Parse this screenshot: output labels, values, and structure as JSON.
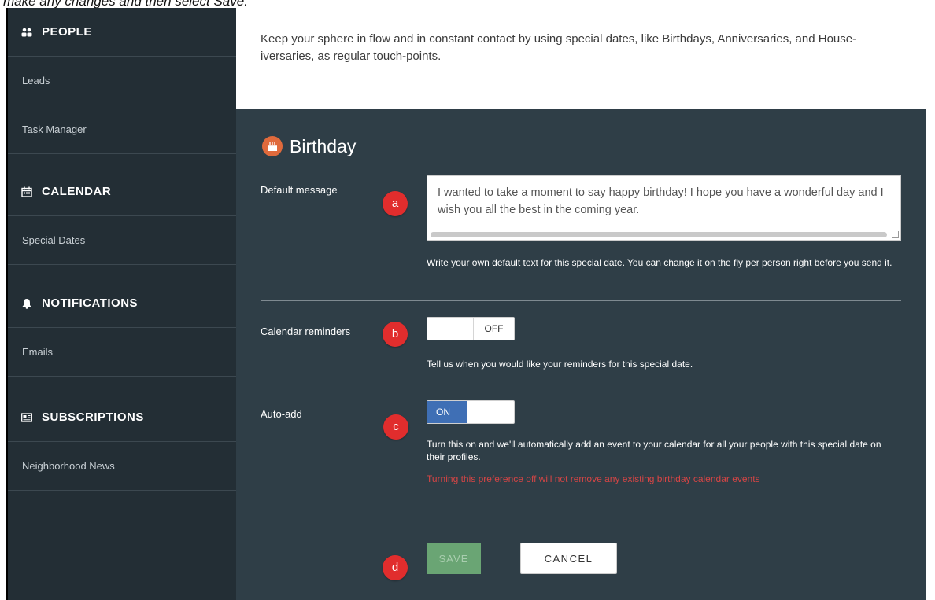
{
  "caption": "make any changes and then select Save.",
  "sidebar": {
    "sections": [
      {
        "id": "people",
        "label": "PEOPLE",
        "icon": "people-icon"
      },
      {
        "id": "calendar",
        "label": "CALENDAR",
        "icon": "calendar-icon"
      },
      {
        "id": "notifications",
        "label": "NOTIFICATIONS",
        "icon": "bell-icon"
      },
      {
        "id": "subscriptions",
        "label": "SUBSCRIPTIONS",
        "icon": "newspaper-icon"
      }
    ],
    "items": {
      "leads": "Leads",
      "task_manager": "Task Manager",
      "special_dates": "Special Dates",
      "emails": "Emails",
      "neighborhood_news": "Neighborhood News"
    }
  },
  "intro": {
    "text": "Keep your sphere in flow and in constant contact by using special dates, like Birthdays, Anniversaries, and House-iversaries, as regular touch-points."
  },
  "form": {
    "title": "Birthday",
    "title_icon": "cake-icon",
    "default_message": {
      "label": "Default message",
      "badge": "a",
      "value": "I wanted to take a moment to say happy birthday! I hope you have a wonderful day and I wish you all the best in the coming year.",
      "help": "Write your own default text for this special date. You can change it on the fly per person right before you send it."
    },
    "calendar_reminders": {
      "label": "Calendar reminders",
      "badge": "b",
      "toggle_state": "OFF",
      "help": "Tell us when you would like your reminders for this special date."
    },
    "auto_add": {
      "label": "Auto-add",
      "badge": "c",
      "toggle_state": "ON",
      "help": "Turn this on and we'll automatically add an event to your calendar for all your people with this special date on their profiles.",
      "warning": "Turning this preference off will not remove any existing birthday calendar events"
    },
    "actions": {
      "badge": "d",
      "save_label": "SAVE",
      "cancel_label": "CANCEL"
    }
  },
  "colors": {
    "sidebar_bg": "#232e35",
    "content_bg": "#2f3e47",
    "badge": "#e12d2d",
    "toggle_on": "#3f6fb5",
    "save_button": "#6aa574",
    "warning_text": "#d64545",
    "cake_icon": "#e06a3c"
  }
}
